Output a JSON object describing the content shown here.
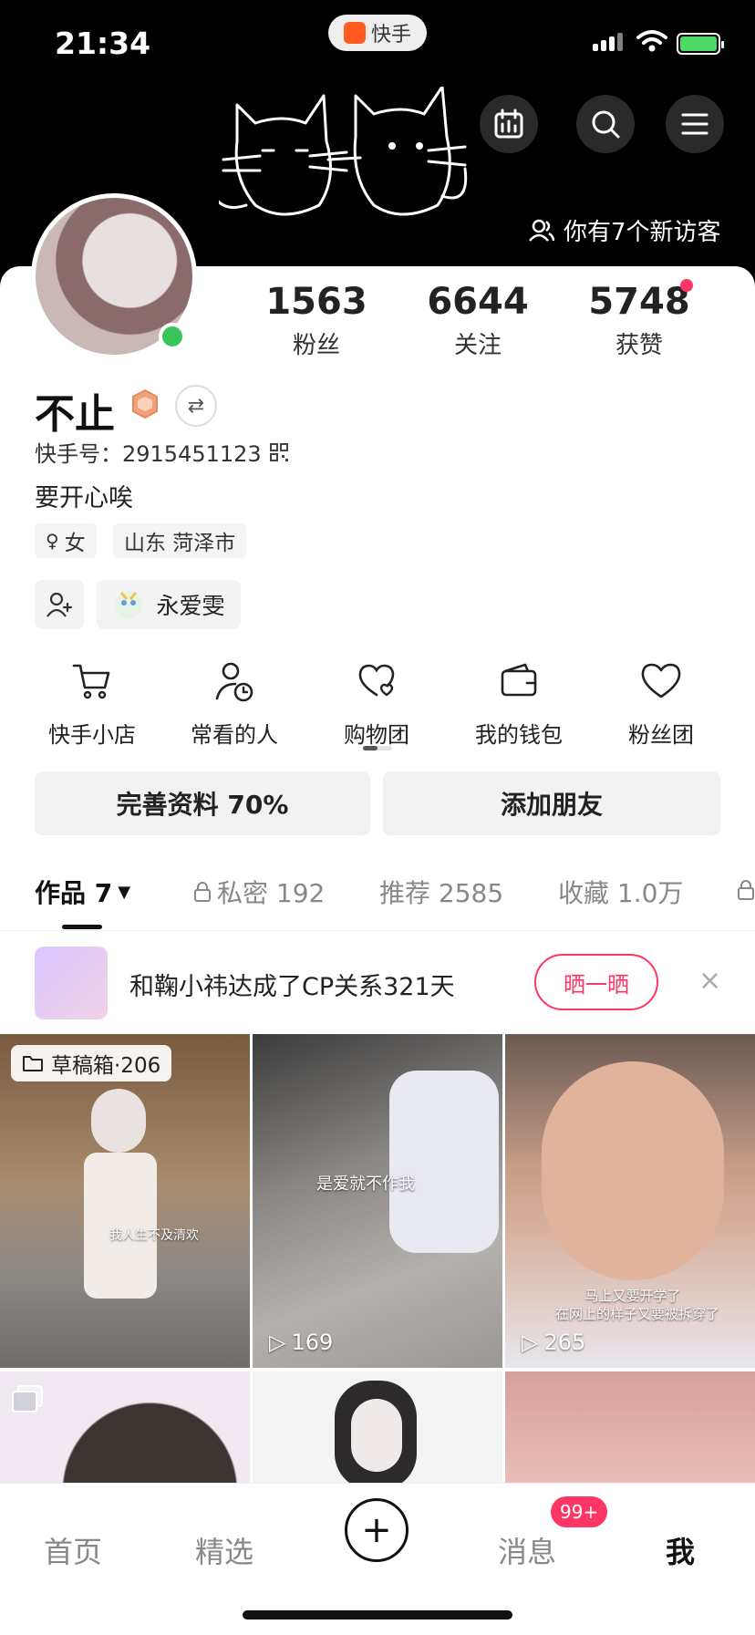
{
  "status_bar": {
    "time": "21:34",
    "app_name": "快手"
  },
  "header": {
    "visitors_text": "你有7个新访客"
  },
  "profile": {
    "name": "不止",
    "kuaishou_id": "快手号：2915451123",
    "bio": "要开心唉",
    "tags": [
      "女",
      "山东 菏泽市"
    ],
    "fan_group": "永爱雯"
  },
  "stats": [
    {
      "value": "1563",
      "label": "粉丝"
    },
    {
      "value": "6644",
      "label": "关注"
    },
    {
      "value": "5748",
      "label": "获赞"
    }
  ],
  "shortcuts": [
    {
      "label": "快手小店",
      "icon": "cart-icon"
    },
    {
      "label": "常看的人",
      "icon": "user-clock-icon"
    },
    {
      "label": "购物团",
      "icon": "heart-bag-icon"
    },
    {
      "label": "我的钱包",
      "icon": "wallet-icon"
    },
    {
      "label": "粉丝团",
      "icon": "heart-icon"
    }
  ],
  "actions": {
    "complete_profile": "完善资料 70%",
    "add_friend": "添加朋友"
  },
  "tabs": [
    {
      "label": "作品 7",
      "active": true
    },
    {
      "label": "私密 192",
      "locked": true
    },
    {
      "label": "推荐 2585"
    },
    {
      "label": "收藏 1.0万"
    }
  ],
  "cp_banner": {
    "text": "和鞠小祎达成了CP关系321天",
    "button": "晒一晒",
    "close": "×"
  },
  "grid": [
    {
      "draft": "草稿箱·206",
      "caption": "我人生不及清欢"
    },
    {
      "plays": "169",
      "caption": "是爱就不作我"
    },
    {
      "plays": "265",
      "caption_lines": [
        "马上又要开学了",
        "在网上的样子又要被拆穿了"
      ]
    }
  ],
  "bottom_nav": {
    "home": "首页",
    "featured": "精选",
    "messages": "消息",
    "me": "我",
    "msg_badge": "99+",
    "plus": "+"
  },
  "colors": {
    "accent": "#fe3666",
    "online": "#38c559",
    "header_bg": "#000000"
  }
}
